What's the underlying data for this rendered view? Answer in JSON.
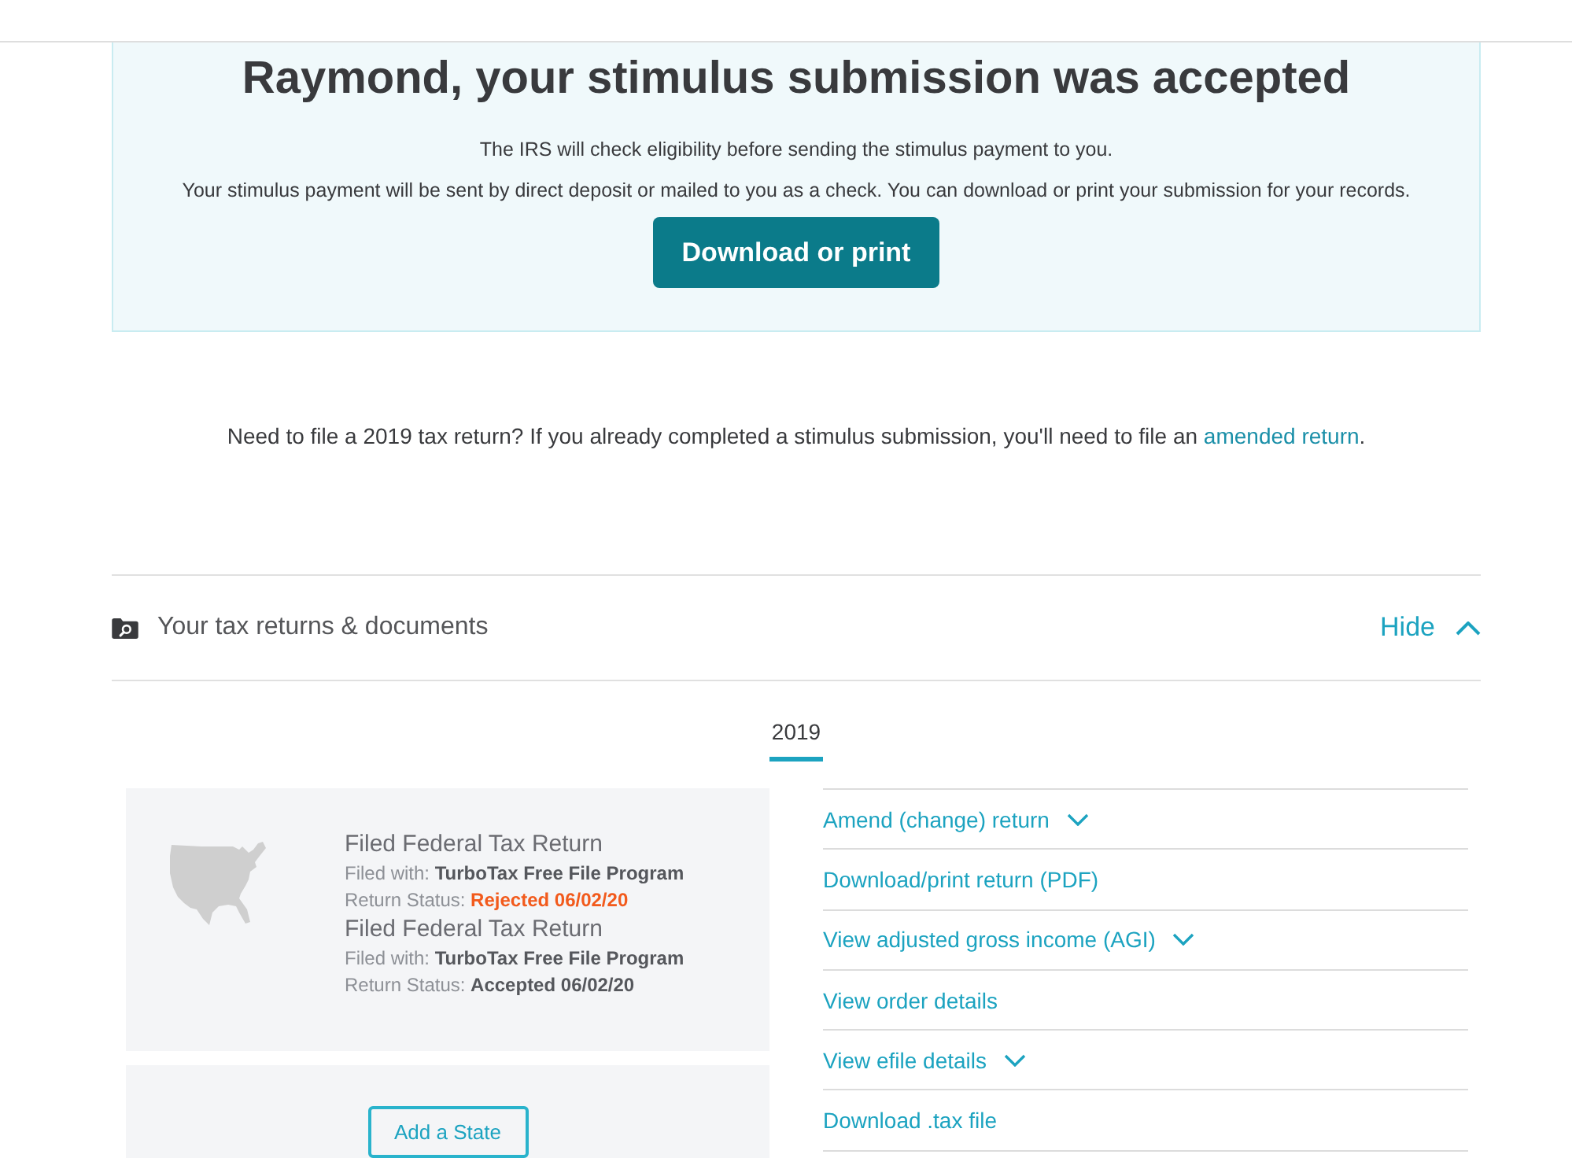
{
  "banner": {
    "title": "Raymond, your stimulus submission was accepted",
    "lines": [
      "The IRS will check eligibility before sending the stimulus payment to you.",
      "Your stimulus payment will be sent by direct deposit or mailed to you as a check. You can download or print your submission for your records."
    ],
    "button": "Download or print"
  },
  "notice": {
    "text": "Need to file a 2019 tax return? If you already completed a stimulus submission, you'll need to file an ",
    "link": "amended return",
    "end": "."
  },
  "documents": {
    "title": "Your tax returns & documents",
    "toggle": "Hide",
    "expanded": true
  },
  "year_tabs": [
    {
      "label": "2019",
      "selected": true
    }
  ],
  "returns": [
    {
      "title": "Filed Federal Tax Return",
      "filed_with": "Filed with: **TurboTax Free File Program**",
      "status": "Return Status: **Rejected 06/02/20**",
      "rejected": true
    },
    {
      "title": "Filed Federal Tax Return",
      "filed_with": "Filed with: **TurboTax Free File Program**",
      "status": "Return Status: **Accepted 06/02/20**",
      "rejected": false
    }
  ],
  "add_state_button": "Add a State",
  "actions": [
    {
      "label": "Amend (change) return",
      "kind": "dropdown"
    },
    {
      "label": "Download/print return (PDF)",
      "kind": "link"
    },
    {
      "label": "View adjusted gross income (AGI)",
      "kind": "dropdown"
    },
    {
      "label": "View order details",
      "kind": "link"
    },
    {
      "label": "View efile details",
      "kind": "dropdown"
    },
    {
      "label": "Download .tax file",
      "kind": "link"
    }
  ]
}
